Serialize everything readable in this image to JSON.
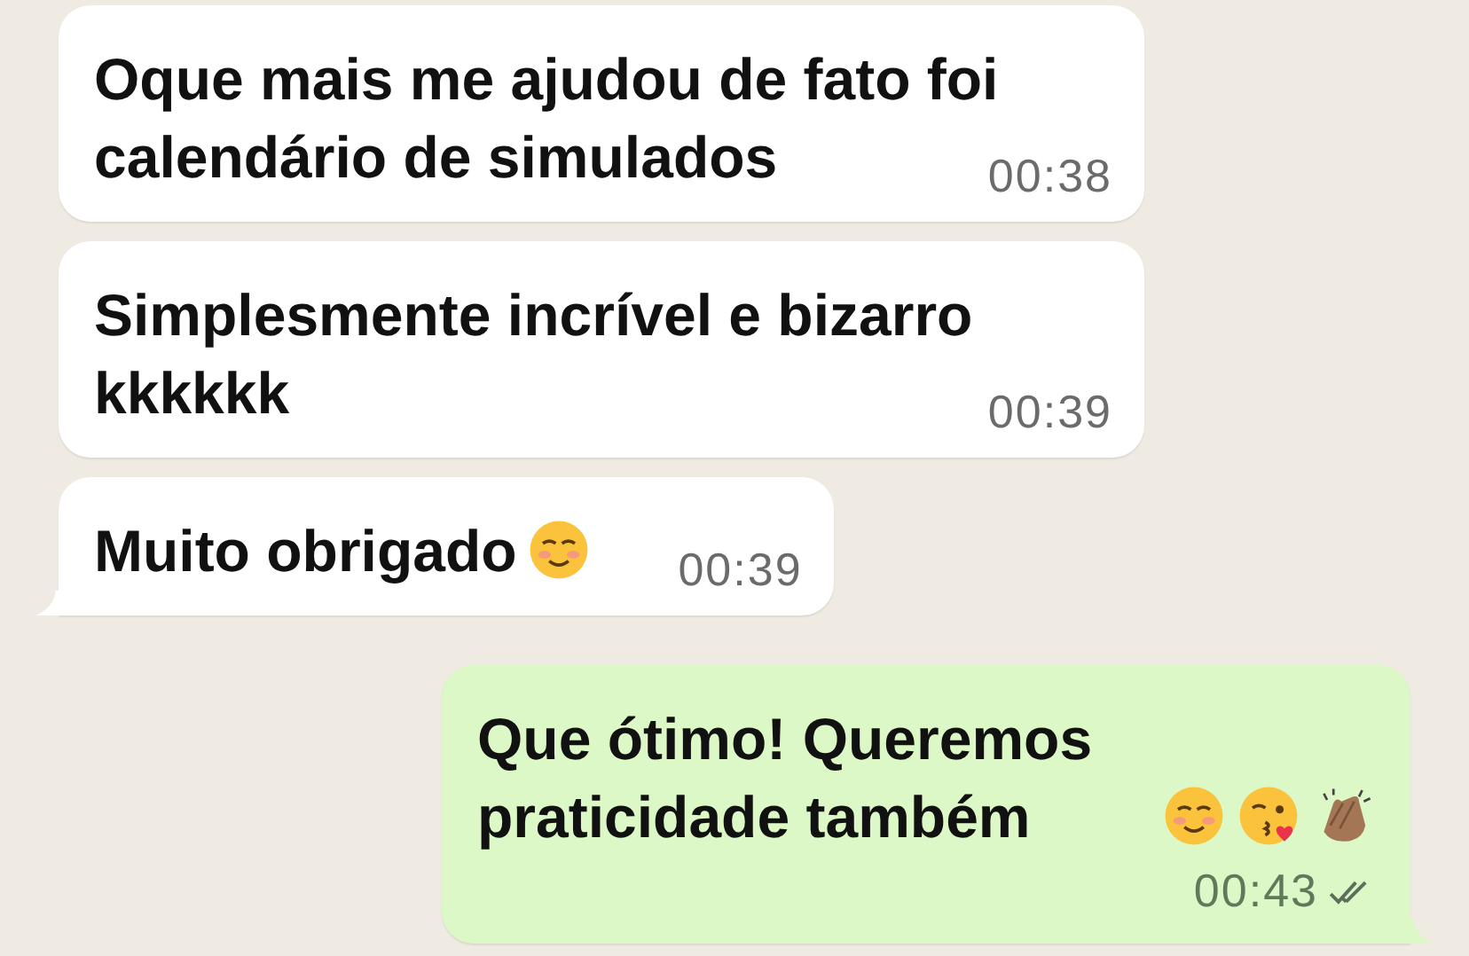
{
  "messages": [
    {
      "kind": "incoming",
      "text": "Oque mais me ajudou de fato foi calendário de simulados",
      "time": "00:38",
      "tail": false
    },
    {
      "kind": "incoming",
      "text": "Simplesmente incrível e bizarro kkkkkk",
      "time": "00:39",
      "tail": false
    },
    {
      "kind": "incoming",
      "text": "Muito obrigado",
      "emojis": [
        {
          "kind": "smiling"
        }
      ],
      "time": "00:39",
      "tail": true
    },
    {
      "kind": "outgoing",
      "text": "Que ótimo! Queremos praticidade também",
      "emojis": [
        {
          "kind": "smiling"
        },
        {
          "kind": "kiss"
        },
        {
          "kind": "clap"
        }
      ],
      "time": "00:43",
      "tail": true,
      "read": false
    }
  ]
}
